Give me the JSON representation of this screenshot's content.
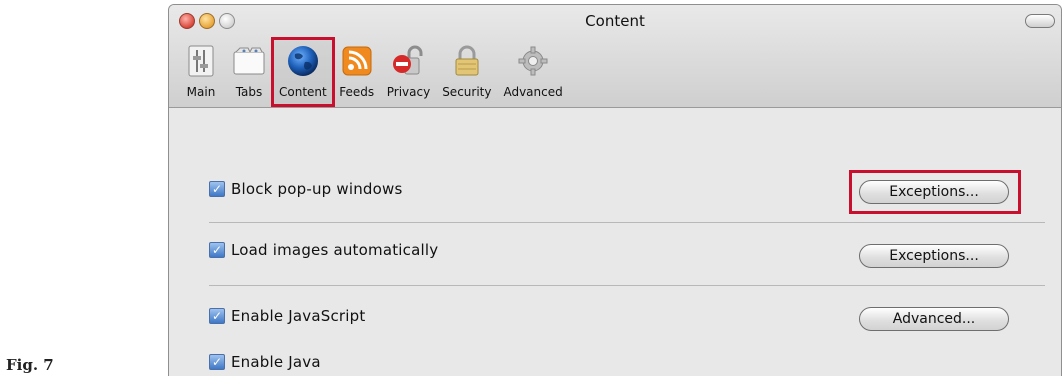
{
  "window": {
    "title": "Content"
  },
  "toolbar": {
    "items": [
      {
        "label": "Main",
        "icon": "main-icon"
      },
      {
        "label": "Tabs",
        "icon": "tabs-icon"
      },
      {
        "label": "Content",
        "icon": "globe-icon",
        "selected": true
      },
      {
        "label": "Feeds",
        "icon": "rss-icon"
      },
      {
        "label": "Privacy",
        "icon": "privacy-icon"
      },
      {
        "label": "Security",
        "icon": "lock-icon"
      },
      {
        "label": "Advanced",
        "icon": "gear-icon"
      }
    ]
  },
  "content": {
    "rows": [
      {
        "label": "Block pop-up windows",
        "checked": true,
        "button": "Exceptions..."
      },
      {
        "label": "Load images automatically",
        "checked": true,
        "button": "Exceptions..."
      },
      {
        "label": "Enable JavaScript",
        "checked": true,
        "button": "Advanced..."
      },
      {
        "label": "Enable Java",
        "checked": true
      }
    ]
  },
  "caption": "Fig. 7",
  "colors": {
    "highlight": "#c8102e",
    "checkbox_blue": "#3f78c6"
  }
}
